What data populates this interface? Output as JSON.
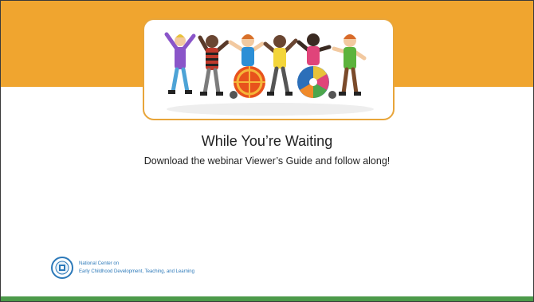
{
  "slide": {
    "title": "While You’re Waiting",
    "subtitle": "Download the webinar Viewer’s Guide and follow along!"
  },
  "logo": {
    "line1": "National Center on",
    "line2": "Early Childhood Development, Teaching, and Learning"
  },
  "colors": {
    "top_band": "#f0a52f",
    "bottom_band": "#4c9a4a",
    "card_border": "#e8a53a",
    "logo_text": "#2c79b9"
  }
}
